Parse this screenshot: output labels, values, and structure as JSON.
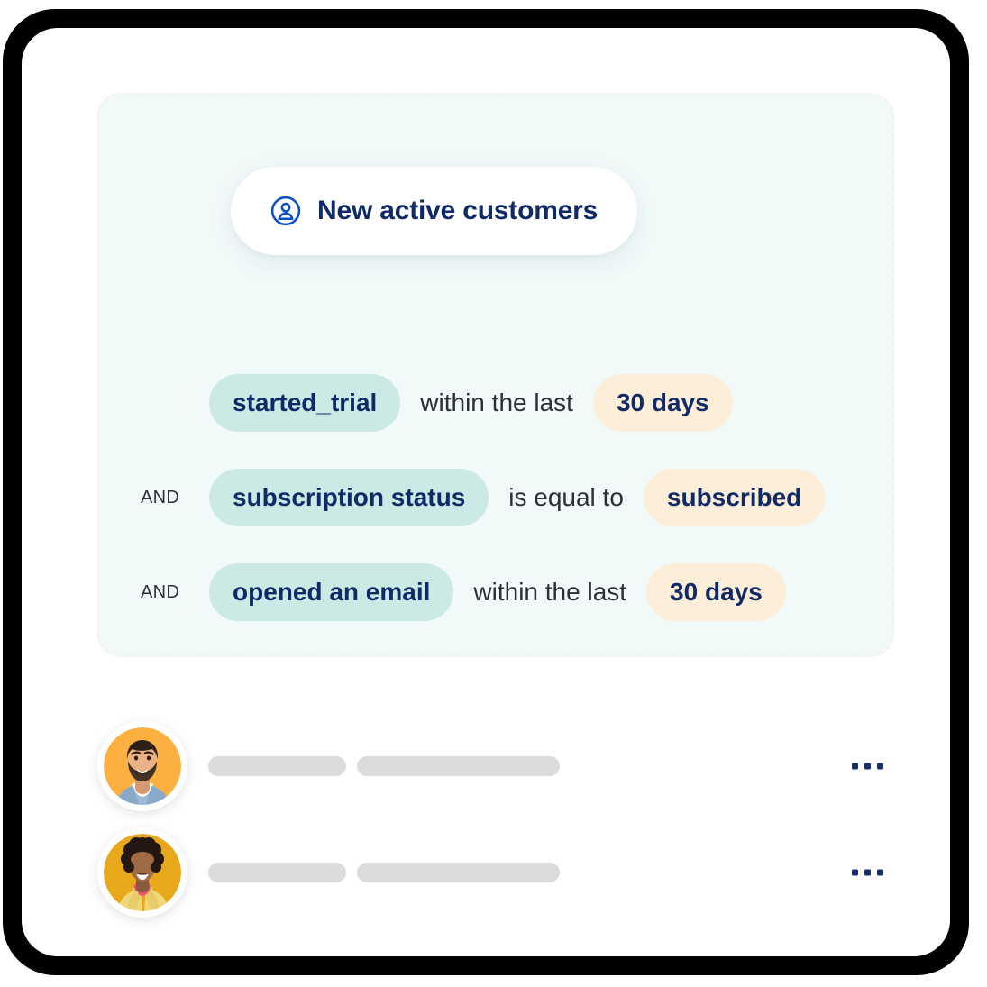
{
  "segment": {
    "icon": "person-circle-icon",
    "title": "New active customers",
    "accent_blue": "#0b4fc4",
    "title_text_color": "#102a68",
    "panel_background": "#f1faf9",
    "field_pill_color": "#cbe9e5",
    "value_pill_color": "#fdeeda"
  },
  "conditions": [
    {
      "conjunction": "",
      "field": "started_trial",
      "operator": "within the last",
      "value": "30 days"
    },
    {
      "conjunction": "AND",
      "field": "subscription status",
      "operator": "is equal to",
      "value": "subscribed"
    },
    {
      "conjunction": "AND",
      "field": "opened an email",
      "operator": "within the last",
      "value": "30 days"
    }
  ],
  "results": [
    {
      "avatar": "avatar-bearded-man",
      "avatar_background": "#fbb040",
      "menu_icon": "more-options-icon"
    },
    {
      "avatar": "avatar-curly-hair-woman",
      "avatar_background": "#e8a81c",
      "menu_icon": "more-options-icon"
    }
  ]
}
